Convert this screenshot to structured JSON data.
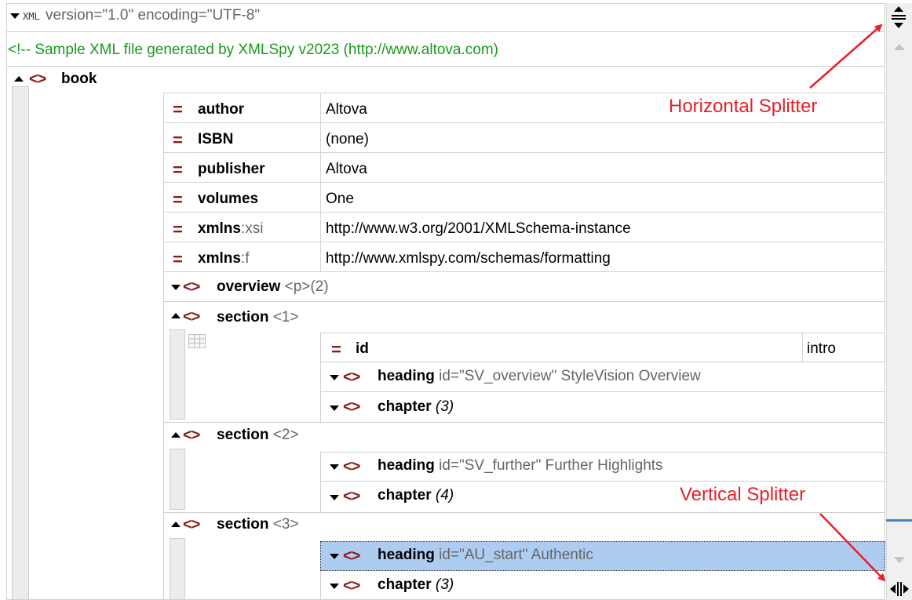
{
  "xml_decl": {
    "badge": "XML",
    "text": "version=\"1.0\" encoding=\"UTF-8\""
  },
  "comment": "<!-- Sample XML file generated by XMLSpy v2023 (http://www.altova.com)",
  "book": {
    "name": "book",
    "attributes": [
      {
        "name": "author",
        "prefix": "",
        "value": "Altova"
      },
      {
        "name": "ISBN",
        "prefix": "",
        "value": "(none)"
      },
      {
        "name": "publisher",
        "prefix": "",
        "value": "Altova"
      },
      {
        "name": "volumes",
        "prefix": "",
        "value": "One"
      },
      {
        "name": "xmlns",
        "prefix": ":xsi",
        "value": "http://www.w3.org/2001/XMLSchema-instance"
      },
      {
        "name": "xmlns",
        "prefix": ":f",
        "value": "http://www.xmlspy.com/schemas/formatting"
      }
    ],
    "overview": {
      "name": "overview",
      "tag": "<p>",
      "count": "(2)"
    },
    "sections": [
      {
        "name": "section",
        "index": "<1>",
        "id_attr": {
          "name": "id",
          "value": "intro"
        },
        "heading": {
          "name": "heading",
          "detail": "id=\"SV_overview\" StyleVision Overview"
        },
        "chapter": {
          "name": "chapter",
          "count": "(3)"
        }
      },
      {
        "name": "section",
        "index": "<2>",
        "heading": {
          "name": "heading",
          "detail": "id=\"SV_further\" Further Highlights"
        },
        "chapter": {
          "name": "chapter",
          "count": "(4)"
        }
      },
      {
        "name": "section",
        "index": "<3>",
        "heading": {
          "name": "heading",
          "detail": "id=\"AU_start\" Authentic"
        },
        "chapter": {
          "name": "chapter",
          "count": "(3)"
        }
      }
    ]
  },
  "annotations": {
    "horizontal": "Horizontal Splitter",
    "vertical": "Vertical Splitter"
  },
  "colors": {
    "element_icon": "#8b1a1a",
    "comment": "#1a9a1a",
    "annotation": "#e8202a",
    "selection": "#aecbf0"
  }
}
